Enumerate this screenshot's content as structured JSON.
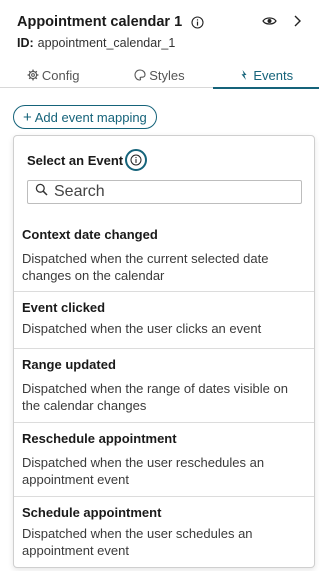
{
  "header": {
    "title": "Appointment calendar 1",
    "id_label": "ID:",
    "id_value": "appointment_calendar_1"
  },
  "tabs": [
    {
      "label": "Config",
      "icon": "gear-icon",
      "active": false
    },
    {
      "label": "Styles",
      "icon": "palette-icon",
      "active": false
    },
    {
      "label": "Events",
      "icon": "lightning-icon",
      "active": true
    }
  ],
  "add_mapping": {
    "label": "Add event mapping"
  },
  "dropdown": {
    "title": "Select an Event",
    "search_placeholder": "Search",
    "events": [
      {
        "name": "Context date changed",
        "description": "Dispatched when the current selected date changes on the calendar"
      },
      {
        "name": "Event clicked",
        "description": "Dispatched when the user clicks an event"
      },
      {
        "name": "Range updated",
        "description": "Dispatched when the range of dates visible on the calendar changes"
      },
      {
        "name": "Reschedule appointment",
        "description": "Dispatched when the user reschedules an appointment event"
      },
      {
        "name": "Schedule appointment",
        "description": "Dispatched when the user schedules an appointment event"
      }
    ]
  },
  "colors": {
    "accent": "#15637a",
    "border": "#cfcfcf",
    "text": "#1a1a1a"
  }
}
